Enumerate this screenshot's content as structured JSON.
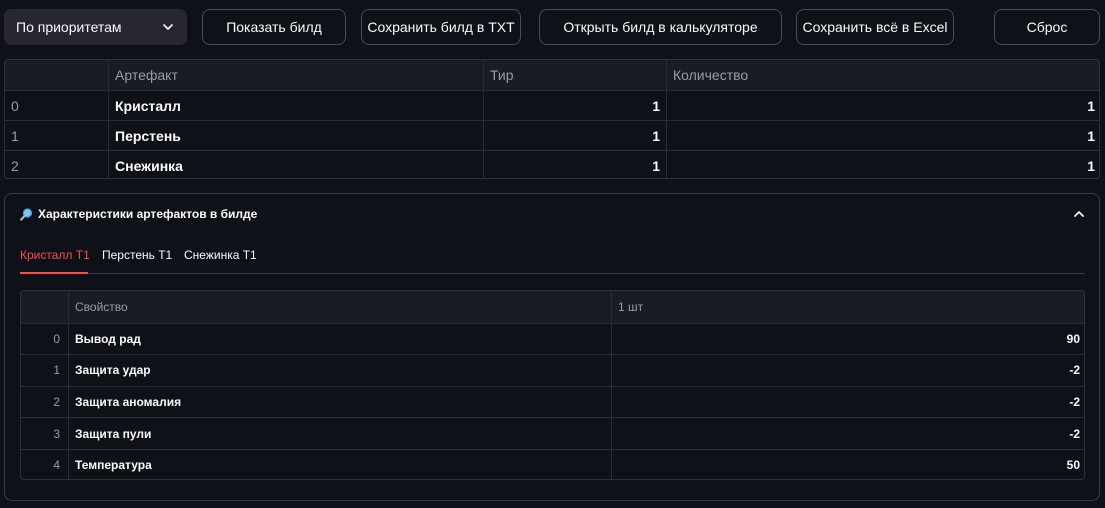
{
  "toolbar": {
    "sort_select": "По приоритетам",
    "show_build": "Показать билд",
    "save_txt": "Сохранить билд в TXT",
    "open_calc": "Открыть билд в калькуляторе",
    "save_excel": "Сохранить всё в Excel",
    "reset": "Сброс"
  },
  "build_table": {
    "columns": [
      "",
      "Артефакт",
      "Тир",
      "Количество"
    ],
    "rows": [
      {
        "index": "0",
        "artifact": "Кристалл",
        "tier": "1",
        "count": "1"
      },
      {
        "index": "1",
        "artifact": "Перстень",
        "tier": "1",
        "count": "1"
      },
      {
        "index": "2",
        "artifact": "Снежинка",
        "tier": "1",
        "count": "1"
      }
    ]
  },
  "expander": {
    "icon": "magnifier-icon",
    "title": "Характеристики артефактов в билде",
    "expanded": true,
    "tabs": [
      "Кристалл T1",
      "Перстень T1",
      "Снежинка T1"
    ],
    "active_tab": 0,
    "table": {
      "columns": [
        "",
        "Свойство",
        "1 шт"
      ],
      "rows": [
        {
          "index": "0",
          "property": "Вывод рад",
          "value": "90"
        },
        {
          "index": "1",
          "property": "Защита удар",
          "value": "-2"
        },
        {
          "index": "2",
          "property": "Защита аномалия",
          "value": "-2"
        },
        {
          "index": "3",
          "property": "Защита пули",
          "value": "-2"
        },
        {
          "index": "4",
          "property": "Температура",
          "value": "50"
        }
      ]
    }
  },
  "colors": {
    "background": "#0e1117",
    "accent": "#ff4b4b",
    "select_bg": "#262730"
  }
}
